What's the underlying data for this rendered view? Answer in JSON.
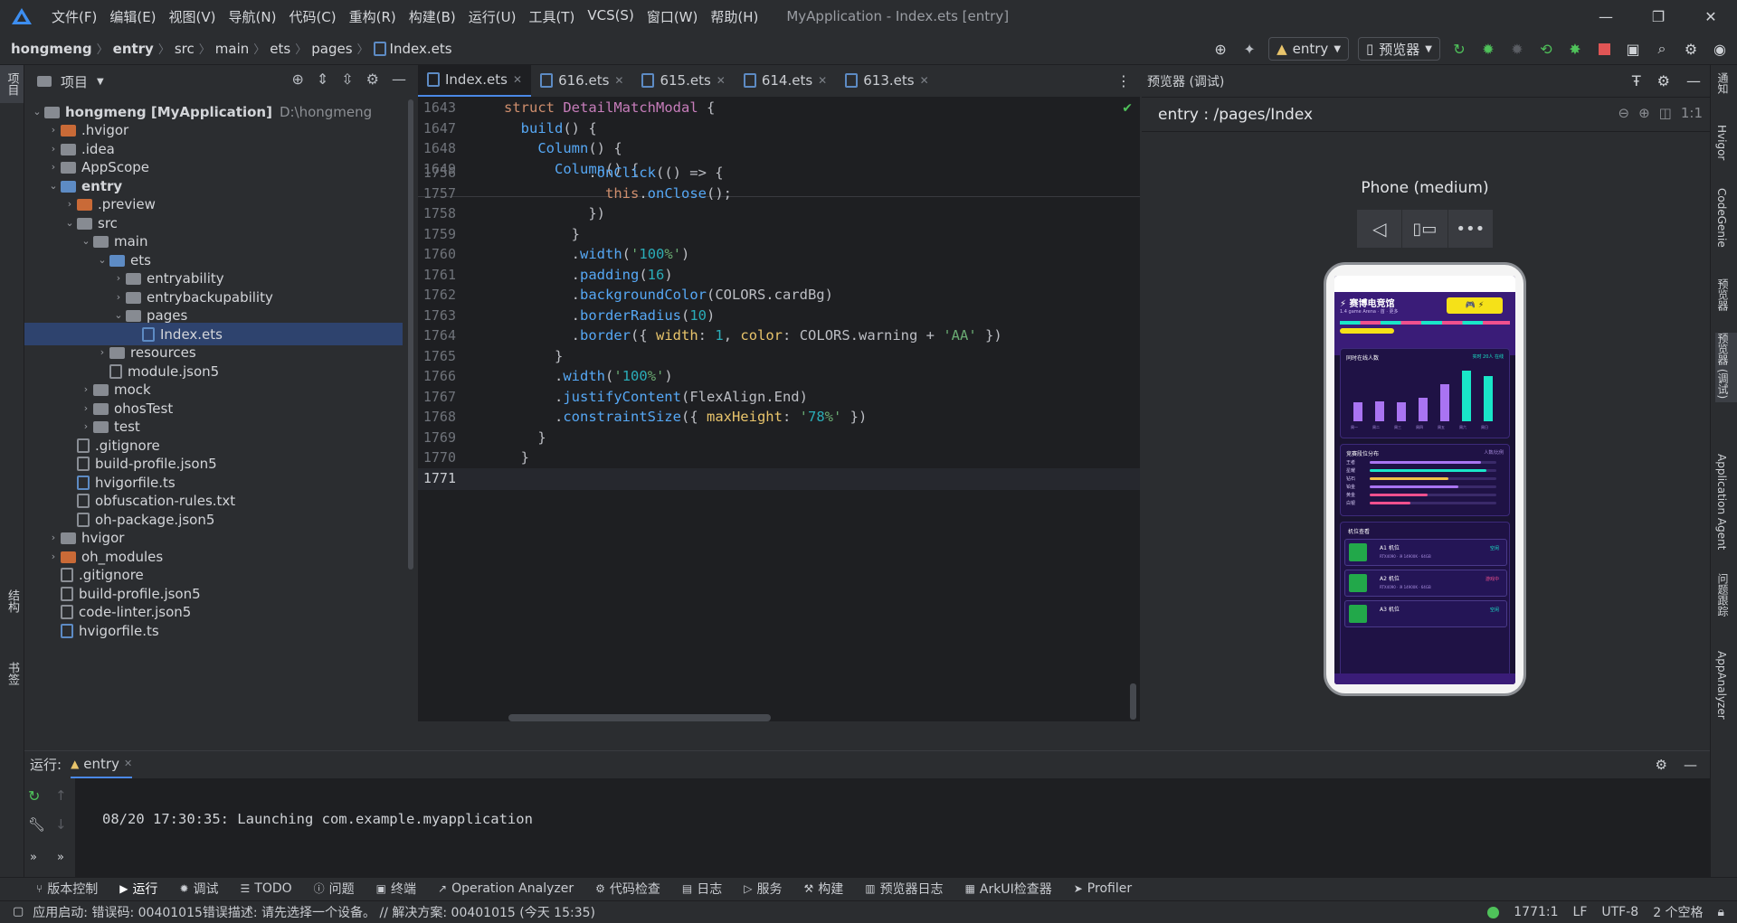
{
  "menubar": {
    "items": [
      "文件(F)",
      "编辑(E)",
      "视图(V)",
      "导航(N)",
      "代码(C)",
      "重构(R)",
      "构建(B)",
      "运行(U)",
      "工具(T)",
      "VCS(S)",
      "窗口(W)",
      "帮助(H)"
    ],
    "window_title": "MyApplication - Index.ets [entry]"
  },
  "navbar": {
    "breadcrumbs": [
      "hongmeng",
      "entry",
      "src",
      "main",
      "ets",
      "pages",
      "Index.ets"
    ],
    "run_config": "entry",
    "device": "预览器"
  },
  "leftstrip": {
    "project_label": "项目",
    "structure_label": "结构",
    "bookmarks_label": "书签"
  },
  "project": {
    "header": "项目",
    "tree": [
      {
        "label": "hongmeng [MyApplication]",
        "extra": "D:\\hongmeng",
        "depth": 0,
        "arrow": "v",
        "icon": "folder"
      },
      {
        "label": ".hvigor",
        "depth": 1,
        "arrow": ">",
        "icon": "folder-orange"
      },
      {
        "label": ".idea",
        "depth": 1,
        "arrow": ">",
        "icon": "folder"
      },
      {
        "label": "AppScope",
        "depth": 1,
        "arrow": ">",
        "icon": "folder"
      },
      {
        "label": "entry",
        "depth": 1,
        "arrow": "v",
        "icon": "folder-blue"
      },
      {
        "label": ".preview",
        "depth": 2,
        "arrow": ">",
        "icon": "folder-orange"
      },
      {
        "label": "src",
        "depth": 2,
        "arrow": "v",
        "icon": "folder"
      },
      {
        "label": "main",
        "depth": 3,
        "arrow": "v",
        "icon": "folder"
      },
      {
        "label": "ets",
        "depth": 4,
        "arrow": "v",
        "icon": "folder-blue"
      },
      {
        "label": "entryability",
        "depth": 5,
        "arrow": ">",
        "icon": "folder"
      },
      {
        "label": "entrybackupability",
        "depth": 5,
        "arrow": ">",
        "icon": "folder"
      },
      {
        "label": "pages",
        "depth": 5,
        "arrow": "v",
        "icon": "folder"
      },
      {
        "label": "Index.ets",
        "depth": 6,
        "arrow": "",
        "icon": "file-ts"
      },
      {
        "label": "resources",
        "depth": 4,
        "arrow": ">",
        "icon": "folder"
      },
      {
        "label": "module.json5",
        "depth": 4,
        "arrow": "",
        "icon": "file"
      },
      {
        "label": "mock",
        "depth": 3,
        "arrow": ">",
        "icon": "folder"
      },
      {
        "label": "ohosTest",
        "depth": 3,
        "arrow": ">",
        "icon": "folder"
      },
      {
        "label": "test",
        "depth": 3,
        "arrow": ">",
        "icon": "folder"
      },
      {
        "label": ".gitignore",
        "depth": 2,
        "arrow": "",
        "icon": "file"
      },
      {
        "label": "build-profile.json5",
        "depth": 2,
        "arrow": "",
        "icon": "file"
      },
      {
        "label": "hvigorfile.ts",
        "depth": 2,
        "arrow": "",
        "icon": "file-ts"
      },
      {
        "label": "obfuscation-rules.txt",
        "depth": 2,
        "arrow": "",
        "icon": "file"
      },
      {
        "label": "oh-package.json5",
        "depth": 2,
        "arrow": "",
        "icon": "file"
      },
      {
        "label": "hvigor",
        "depth": 1,
        "arrow": ">",
        "icon": "folder"
      },
      {
        "label": "oh_modules",
        "depth": 1,
        "arrow": ">",
        "icon": "folder-orange"
      },
      {
        "label": ".gitignore",
        "depth": 1,
        "arrow": "",
        "icon": "file"
      },
      {
        "label": "build-profile.json5",
        "depth": 1,
        "arrow": "",
        "icon": "file"
      },
      {
        "label": "code-linter.json5",
        "depth": 1,
        "arrow": "",
        "icon": "file"
      },
      {
        "label": "hvigorfile.ts",
        "depth": 1,
        "arrow": "",
        "icon": "file-ts"
      }
    ]
  },
  "editor": {
    "tabs": [
      {
        "label": "Index.ets"
      },
      {
        "label": "616.ets"
      },
      {
        "label": "615.ets"
      },
      {
        "label": "614.ets"
      },
      {
        "label": "613.ets"
      }
    ],
    "sticky": [
      {
        "ln": "1643",
        "code": "struct DetailMatchModal {"
      },
      {
        "ln": "1647",
        "code": "  build() {"
      },
      {
        "ln": "1648",
        "code": "    Column() {"
      },
      {
        "ln": "1649",
        "code": "      Column() {"
      }
    ],
    "lines": [
      {
        "ln": "1756",
        "code": "          .onClick(() => {"
      },
      {
        "ln": "1757",
        "code": "            this.onClose();"
      },
      {
        "ln": "1758",
        "code": "          })"
      },
      {
        "ln": "1759",
        "code": "        }"
      },
      {
        "ln": "1760",
        "code": "        .width('100%')"
      },
      {
        "ln": "1761",
        "code": "        .padding(16)"
      },
      {
        "ln": "1762",
        "code": "        .backgroundColor(COLORS.cardBg)"
      },
      {
        "ln": "1763",
        "code": "        .borderRadius(10)"
      },
      {
        "ln": "1764",
        "code": "        .border({ width: 1, color: COLORS.warning + 'AA' })"
      },
      {
        "ln": "1765",
        "code": "      }"
      },
      {
        "ln": "1766",
        "code": "      .width('100%')"
      },
      {
        "ln": "1767",
        "code": "      .justifyContent(FlexAlign.End)"
      },
      {
        "ln": "1768",
        "code": "      .constraintSize({ maxHeight: '78%' })"
      },
      {
        "ln": "1769",
        "code": "    }"
      },
      {
        "ln": "1770",
        "code": "  }"
      },
      {
        "ln": "1771",
        "code": ""
      }
    ]
  },
  "preview": {
    "header": "预览器 (调试)",
    "route": "entry : /pages/Index",
    "device_label": "Phone (medium)",
    "app": {
      "title": "⚡ 赛博电竞馆",
      "subtitle": "1.4 game Arena · 首 · 更多",
      "card1_title": "同时在线人数",
      "card1_note": "实时 20人 在线",
      "bars": [
        22,
        24,
        22,
        28,
        44,
        60,
        54
      ],
      "bar_labels": [
        "周一",
        "周二",
        "周三",
        "周四",
        "周五",
        "周六",
        "周日"
      ],
      "card2_title": "竞赛段位分布",
      "card2_note": "人数/比例",
      "ranks": [
        {
          "name": "王者",
          "value": 0.88,
          "color": "#a974f2"
        },
        {
          "name": "星耀",
          "value": 0.92,
          "color": "#19e6c8"
        },
        {
          "name": "钻石",
          "value": 0.62,
          "color": "#f2c14a"
        },
        {
          "name": "铂金",
          "value": 0.7,
          "color": "#a974f2"
        },
        {
          "name": "黄金",
          "value": 0.46,
          "color": "#f0508e"
        },
        {
          "name": "白银",
          "value": 0.32,
          "color": "#f0508e"
        }
      ],
      "card3_title": "机位查看",
      "machines": [
        {
          "name": "A1 机位",
          "status": "空闲",
          "spec": "RTX4090 · i9 14900K · 64GB"
        },
        {
          "name": "A2 机位",
          "status": "游戏中",
          "spec": "RTX4090 · i9 14900K · 64GB"
        },
        {
          "name": "A3 机位",
          "status": "空闲",
          "spec": ""
        }
      ]
    }
  },
  "rightstrip": [
    "通知",
    "Hvigor",
    "CodeGenie",
    "预览器",
    "预览器 (调试)",
    "Application Agent",
    "问题跟踪",
    "AppAnalyzer"
  ],
  "runpanel": {
    "label": "运行:",
    "tab": "entry",
    "log": "08/20 17:30:35: Launching com.example.myapplication"
  },
  "bottombar": [
    "版本控制",
    "运行",
    "调试",
    "TODO",
    "问题",
    "终端",
    "Operation Analyzer",
    "代码检查",
    "日志",
    "服务",
    "构建",
    "预览器日志",
    "ArkUI检查器",
    "Profiler"
  ],
  "statusbar": {
    "message": "应用启动: 错误码: 00401015错误描述: 请先选择一个设备。 // 解决方案: 00401015 (今天 15:35)",
    "position": "1771:1",
    "line_sep": "LF",
    "encoding": "UTF-8",
    "indent": "2 个空格"
  }
}
